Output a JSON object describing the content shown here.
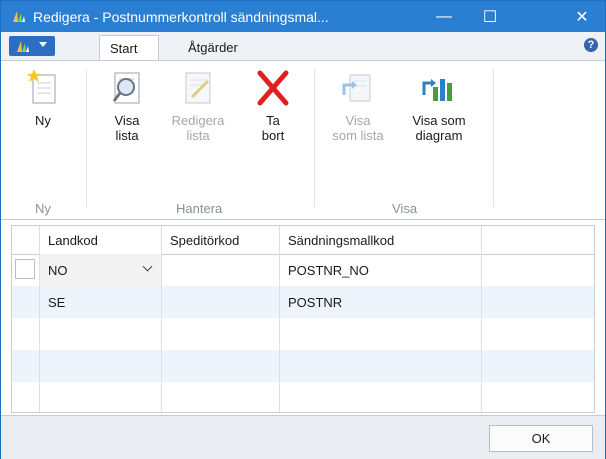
{
  "window": {
    "title": "Redigera - Postnummerkontroll sändningsmal...",
    "minimize_glyph": "—",
    "maximize_glyph": "☐",
    "close_glyph": "✕"
  },
  "ribbon": {
    "tabs": [
      {
        "label": "Start",
        "active": true
      },
      {
        "label": "Åtgärder",
        "active": false
      }
    ],
    "help_glyph": "?",
    "groups": [
      {
        "label": "Ny",
        "buttons": [
          {
            "label1": "Ny",
            "label2": "",
            "icon": "new-document-icon",
            "enabled": true
          }
        ]
      },
      {
        "label": "Hantera",
        "buttons": [
          {
            "label1": "Visa",
            "label2": "lista",
            "icon": "view-list-icon",
            "enabled": true
          },
          {
            "label1": "Redigera",
            "label2": "lista",
            "icon": "edit-list-icon",
            "enabled": false
          },
          {
            "label1": "Ta",
            "label2": "bort",
            "icon": "delete-icon",
            "enabled": true
          }
        ]
      },
      {
        "label": "Visa",
        "buttons": [
          {
            "label1": "Visa",
            "label2": "som lista",
            "icon": "show-as-list-icon",
            "enabled": false
          },
          {
            "label1": "Visa som",
            "label2": "diagram",
            "icon": "chart-icon",
            "enabled": true
          }
        ]
      }
    ]
  },
  "grid": {
    "columns": [
      "Landkod",
      "Speditörkod",
      "Sändningsmallkod"
    ],
    "rows": [
      {
        "landkod": "NO",
        "speditorkod": "",
        "sandningsmallkod": "POSTNR_NO"
      },
      {
        "landkod": "SE",
        "speditorkod": "",
        "sandningsmallkod": "POSTNR"
      }
    ]
  },
  "footer": {
    "ok_label": "OK"
  },
  "colors": {
    "titlebar": "#2b7fd2",
    "alt_row": "#eef4fc",
    "delete_red": "#e02020"
  }
}
